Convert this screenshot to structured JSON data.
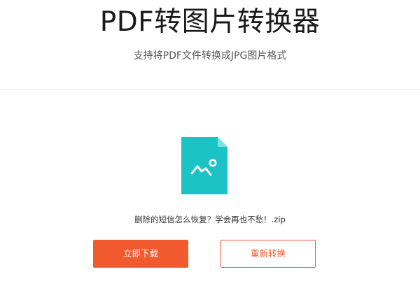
{
  "header": {
    "title": "PDF转图片转换器",
    "subtitle": "支持将PDF文件转换成JPG图片格式"
  },
  "result": {
    "file_icon": "image-file-icon",
    "file_name": "删除的短信怎么恢复？学会再也不愁！.zip"
  },
  "actions": {
    "download_label": "立即下载",
    "reconvert_label": "重新转换"
  },
  "colors": {
    "accent": "#f05a2e",
    "file_icon": "#1cc3c4",
    "file_icon_fold": "#7fe0e1"
  }
}
